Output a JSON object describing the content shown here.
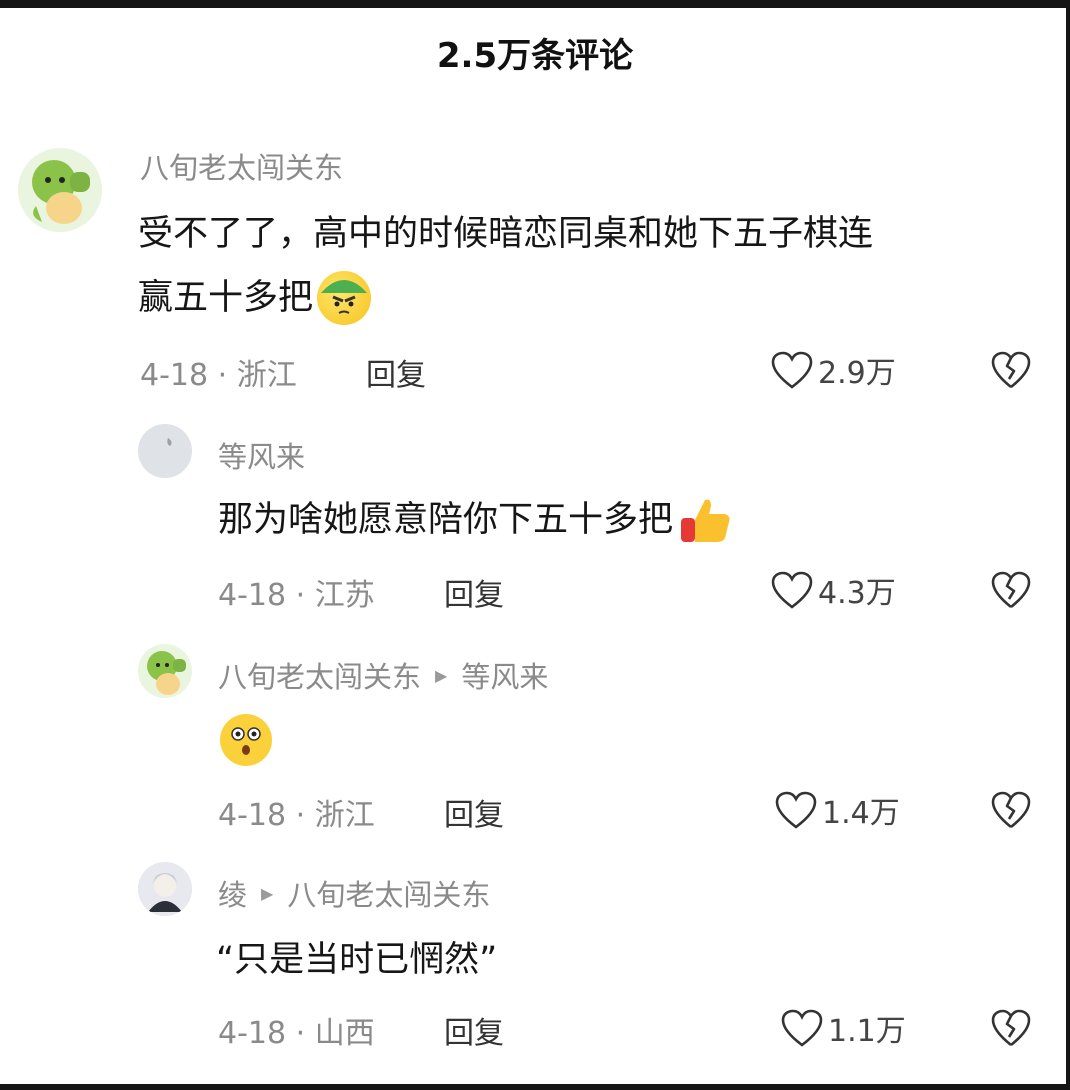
{
  "header": {
    "title": "2.5万条评论"
  },
  "comments": [
    {
      "username": "八旬老太闯关东",
      "content_lines": [
        "受不了了，高中的时候暗恋同桌和她下五子棋连",
        "赢五十多把"
      ],
      "date_location": "4-18 · 浙江",
      "reply_label": "回复",
      "likes": "2.9万",
      "emoji": "angry-helmet-emoji"
    },
    {
      "username": "等风来",
      "content": "那为啥她愿意陪你下五十多把",
      "date_location": "4-18 · 江苏",
      "reply_label": "回复",
      "likes": "4.3万",
      "emoji": "thumbs-up-emoji"
    },
    {
      "username": "八旬老太闯关东",
      "reply_to": "等风来",
      "content": "",
      "date_location": "4-18 · 浙江",
      "reply_label": "回复",
      "likes": "1.4万",
      "emoji": "shocked-face-emoji"
    },
    {
      "username": "绫",
      "reply_to": "八旬老太闯关东",
      "content": "“只是当时已惘然”",
      "date_location": "4-18 · 山西",
      "reply_label": "回复",
      "likes": "1.1万"
    }
  ],
  "colors": {
    "text": "#161616",
    "muted": "#8a8a8a",
    "avatar_green": "#8bc34a"
  }
}
